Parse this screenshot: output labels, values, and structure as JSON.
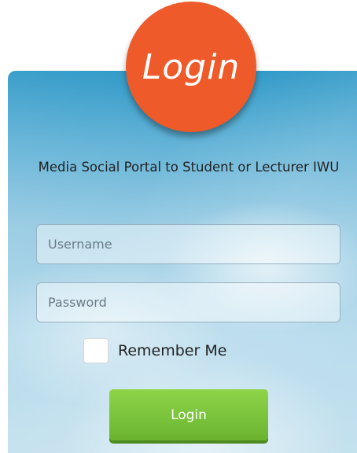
{
  "header": {
    "badge_text": "Login"
  },
  "intro": {
    "text": "Media Social Portal to Student or Lecturer IWU"
  },
  "form": {
    "username_placeholder": "Username",
    "password_placeholder": "Password",
    "remember_label": "Remember Me",
    "remember_checked": false,
    "submit_label": "Login"
  },
  "colors": {
    "badge": "#ee5a2a",
    "submit": "#7ac33c",
    "panel_top": "#2b97c6",
    "panel_bottom": "#c4e1ee"
  }
}
